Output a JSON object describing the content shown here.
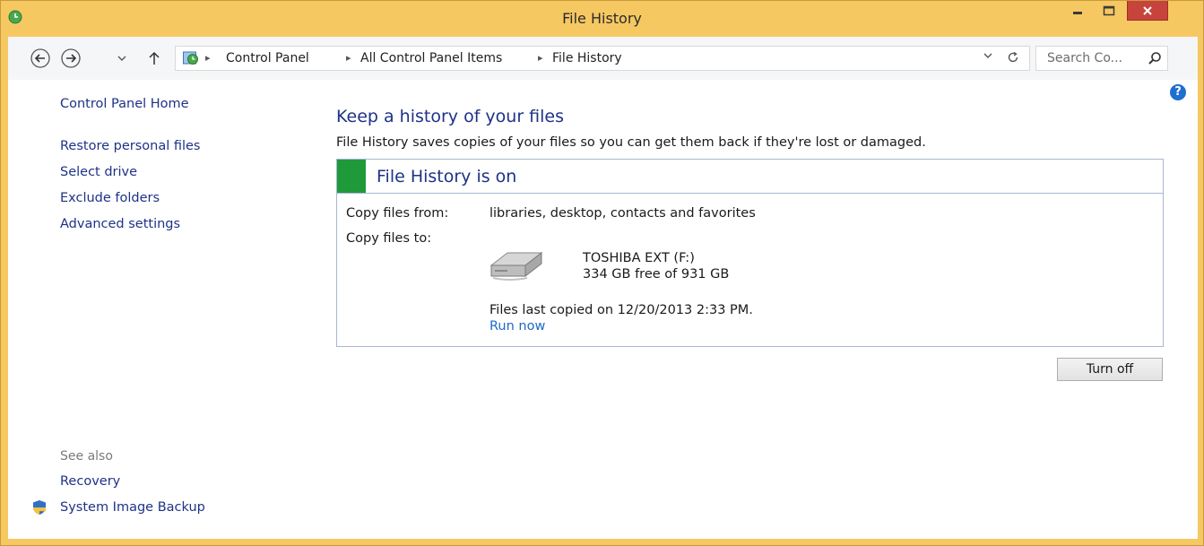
{
  "window": {
    "title": "File History"
  },
  "address": {
    "breadcrumbs": [
      "Control Panel",
      "All Control Panel Items",
      "File History"
    ],
    "search_placeholder": "Search Co..."
  },
  "sidebar": {
    "home": "Control Panel Home",
    "links": [
      "Restore personal files",
      "Select drive",
      "Exclude folders",
      "Advanced settings"
    ],
    "see_also_label": "See also",
    "see_also": [
      "Recovery",
      "System Image Backup"
    ]
  },
  "main": {
    "heading": "Keep a history of your files",
    "description": "File History saves copies of your files so you can get them back if they're lost or damaged.",
    "status_title": "File History is on",
    "copy_from_label": "Copy files from:",
    "copy_from_value": "libraries, desktop, contacts and favorites",
    "copy_to_label": "Copy files to:",
    "drive_name": "TOSHIBA EXT (F:)",
    "drive_free": "334 GB free of 931 GB",
    "last_copied": "Files last copied on 12/20/2013 2:33 PM.",
    "run_now": "Run now",
    "turn_off": "Turn off"
  },
  "colors": {
    "title_bar": "#f6c862",
    "link": "#1e3287",
    "status_on": "#1f9a3a",
    "close_button": "#c7443c"
  }
}
